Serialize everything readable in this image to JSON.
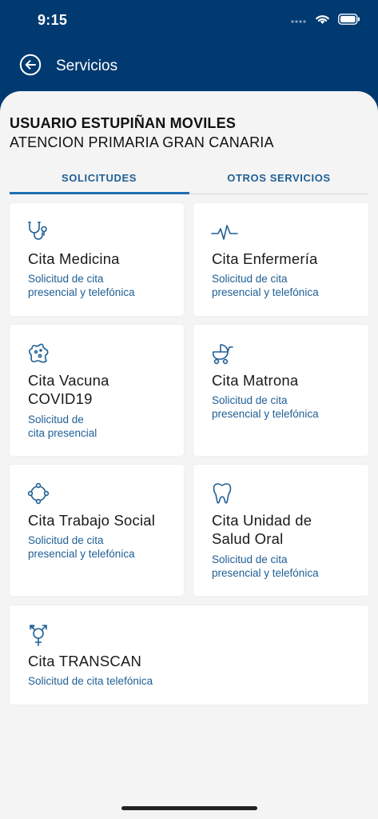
{
  "status": {
    "time": "9:15"
  },
  "appbar": {
    "title": "Servicios"
  },
  "user": {
    "name": "USUARIO ESTUPIÑAN MOVILES",
    "center": "ATENCION PRIMARIA GRAN CANARIA"
  },
  "tabs": [
    {
      "label": "SOLICITUDES",
      "active": true
    },
    {
      "label": "OTROS SERVICIOS",
      "active": false
    }
  ],
  "cards": [
    {
      "icon": "stethoscope-icon",
      "title": "Cita Medicina",
      "subtitle": "Solicitud de cita\npresencial y telefónica"
    },
    {
      "icon": "heartbeat-icon",
      "title": "Cita Enfermería",
      "subtitle": "Solicitud de cita\npresencial y telefónica"
    },
    {
      "icon": "virus-icon",
      "title": "Cita Vacuna\nCOVID19",
      "subtitle": "Solicitud de\ncita presencial"
    },
    {
      "icon": "baby-carriage-icon",
      "title": "Cita Matrona",
      "subtitle": "Solicitud de cita\npresencial y telefónica"
    },
    {
      "icon": "social-circle-icon",
      "title": "Cita Trabajo Social",
      "subtitle": "Solicitud de cita\npresencial y telefónica"
    },
    {
      "icon": "tooth-icon",
      "title": "Cita Unidad de\nSalud Oral",
      "subtitle": "Solicitud de cita\npresencial y telefónica"
    },
    {
      "icon": "transgender-icon",
      "title": "Cita TRANSCAN",
      "subtitle": "Solicitud de cita telefónica"
    }
  ],
  "colors": {
    "brand": "#003a70",
    "accent": "#1f5f95",
    "background": "#f4f4f4"
  }
}
